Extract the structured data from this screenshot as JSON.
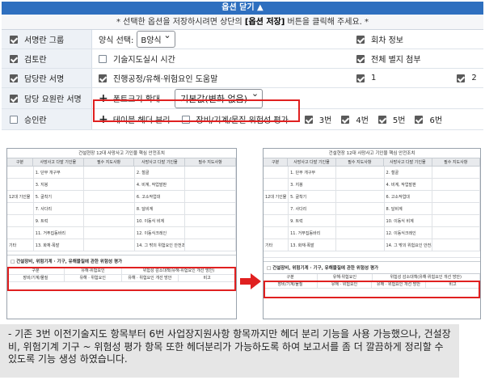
{
  "panel": {
    "header": "옵션 닫기 ▲",
    "notice_prefix": "* 선택한 옵션을 저장하시려면 상단의 ",
    "notice_bold": "[옵션 저장]",
    "notice_suffix": " 버튼을 클릭해 주세요. *"
  },
  "rows": {
    "r1": {
      "left": "서명란 그룹",
      "mid_label": "양식 선택:",
      "select_value": "B양식",
      "right": "회차 정보"
    },
    "r2": {
      "left": "검토란",
      "mid": "기술지도실시 시간",
      "right": "전체 별지 첨부"
    },
    "r3": {
      "left": "담당란 서명",
      "mid": "진행공정/유해·위험요인 도움말",
      "right_a": "1",
      "right_b": "2"
    },
    "r4": {
      "left": "담당 요원란 서명",
      "mid": "폰트크기 확대",
      "select_value": "기본값(변화 없음)"
    },
    "r5": {
      "left": "승인란",
      "mid": "테이블 헤더 분리",
      "mid2": "장비/기계/물질 위험성 평가",
      "opts": [
        "3번",
        "4번",
        "5번",
        "6번"
      ]
    }
  },
  "table": {
    "title": "건설현장 12대 사망사고 기인물 핵심 안전조치",
    "headers": [
      "구분",
      "사망사고 다발 기인물",
      "필수 지도사항",
      "사망사고 다발 기인물",
      "필수 지도사항"
    ],
    "rows": [
      [
        "",
        "1. 단부 개구부",
        "",
        "2. 철골",
        ""
      ],
      [
        "",
        "3. 지붕",
        "",
        "4. 비계, 작업발판",
        ""
      ],
      [
        "12대 기인물",
        "5. 굴착기",
        "",
        "6. 고소작업대",
        ""
      ],
      [
        "",
        "7. 사다리",
        "",
        "8. 달비계",
        ""
      ],
      [
        "",
        "9. 트럭",
        "",
        "10. 이동식 비계",
        ""
      ],
      [
        "",
        "11. 거푸집동바리",
        "",
        "12. 이동식크레인",
        ""
      ],
      [
        "기타",
        "13. 화재·폭발",
        "",
        "14. 그 밖의 위험요인 안전조치",
        ""
      ]
    ],
    "section": "□ 건설장비, 위험기계 · 기구, 유해물질에 관한 위험성 평가",
    "foot1": [
      "구분",
      "유해·위험요인",
      "위험성 감소대책(유해·위험요인 개선 방안)"
    ],
    "foot2": [
      "장비/기계/물질",
      "유해 · 위험요인",
      "유해 · 위험요인 개선 방안",
      "비고"
    ]
  },
  "description": "- 기존 3번 이전기술지도 항목부터 6번 사업장지원사항 항목까지만 헤더 분리 기능을 사용 가능했으나, 건설장비, 위험기계 기구 ~ 위험성 평가 항목 또한 헤더분리가 가능하도록 하여 보고서를 좀 더 깔끔하게 정리할 수 있도록 기능 생성 하였습니다.",
  "colors": {
    "header_bg": "#2e6fbf",
    "highlight": "#e02020"
  }
}
